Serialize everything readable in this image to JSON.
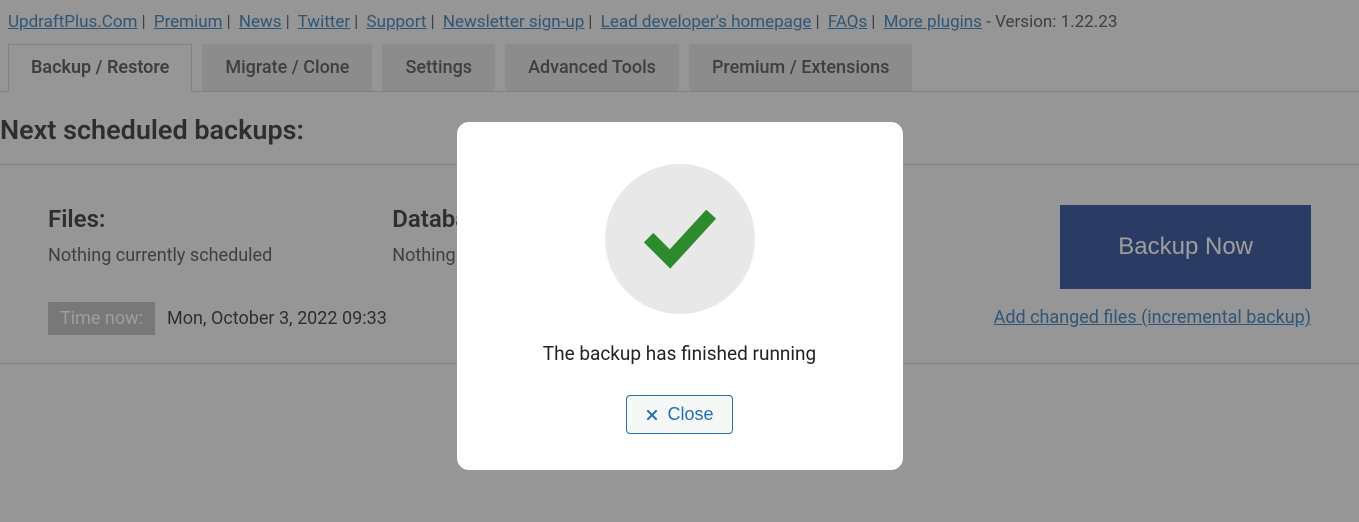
{
  "header": {
    "links": [
      {
        "label": "UpdraftPlus.Com"
      },
      {
        "label": "Premium"
      },
      {
        "label": "News"
      },
      {
        "label": "Twitter"
      },
      {
        "label": "Support"
      },
      {
        "label": "Newsletter sign-up"
      },
      {
        "label": "Lead developer's homepage"
      },
      {
        "label": "FAQs"
      },
      {
        "label": "More plugins"
      }
    ],
    "version_text": " - Version: 1.22.23"
  },
  "tabs": [
    {
      "label": "Backup / Restore",
      "active": true
    },
    {
      "label": "Migrate / Clone",
      "active": false
    },
    {
      "label": "Settings",
      "active": false
    },
    {
      "label": "Advanced Tools",
      "active": false
    },
    {
      "label": "Premium / Extensions",
      "active": false
    }
  ],
  "section": {
    "title": "Next scheduled backups:",
    "files": {
      "heading": "Files:",
      "status": "Nothing currently scheduled"
    },
    "database": {
      "heading": "Database:",
      "status": "Nothing currently scheduled"
    },
    "time_label": "Time now:",
    "time_value": "Mon, October 3, 2022 09:33"
  },
  "actions": {
    "backup_now": "Backup Now",
    "incremental": "Add changed files (incremental backup)"
  },
  "modal": {
    "message": "The backup has finished running",
    "close": "Close"
  }
}
